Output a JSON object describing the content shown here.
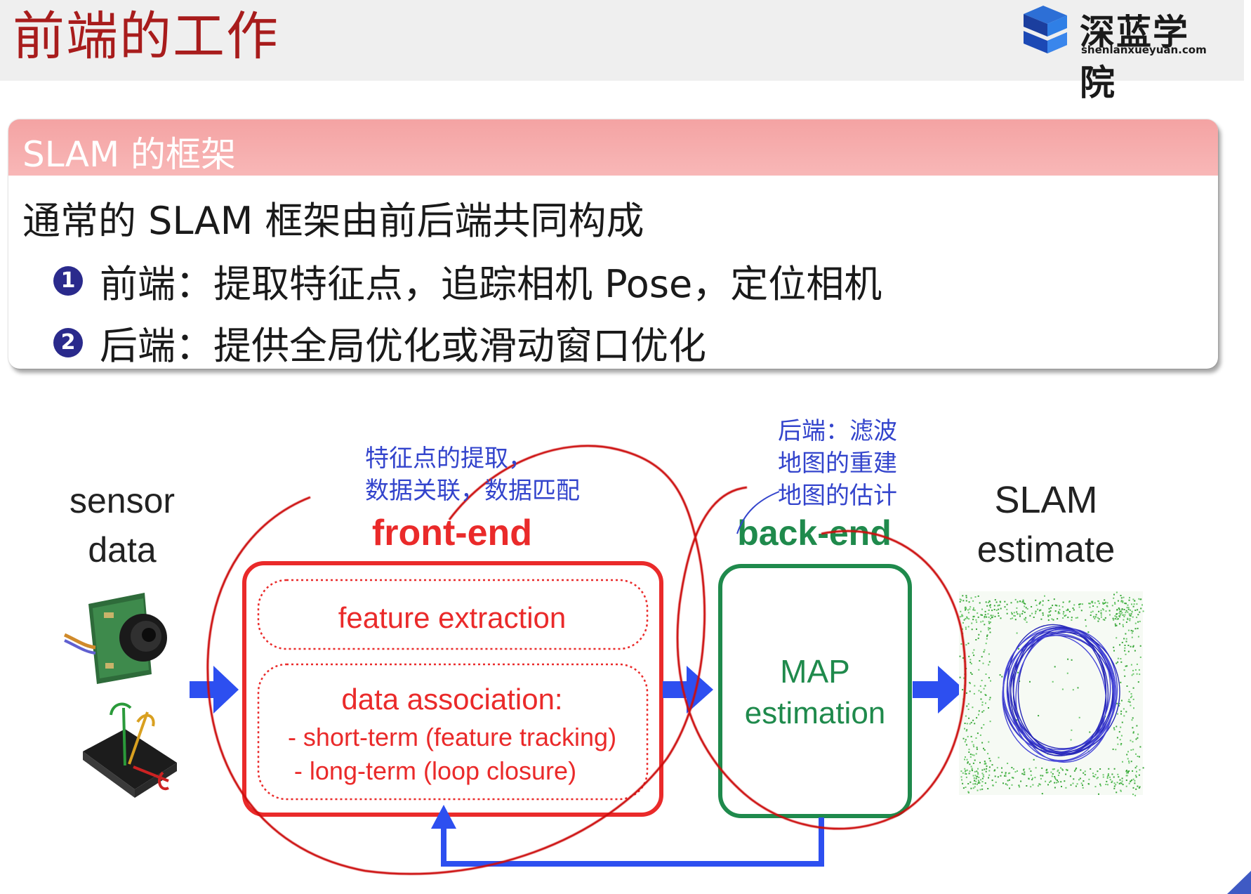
{
  "header": {
    "title": "前端的工作",
    "logo_cn": "深蓝学院",
    "logo_en": "shenlanxueyuan.com"
  },
  "card": {
    "title": "SLAM 的框架",
    "intro": "通常的 SLAM 框架由前后端共同构成",
    "bullets": [
      {
        "num": "1",
        "text": "前端：提取特征点，追踪相机 Pose，定位相机"
      },
      {
        "num": "2",
        "text": "后端：提供全局优化或滑动窗口优化"
      }
    ]
  },
  "annotations": {
    "front_note_line1": "特征点的提取，",
    "front_note_line2": "数据关联，数据匹配",
    "back_note_line1": "后端：滤波",
    "back_note_line2": "地图的重建",
    "back_note_line3": "地图的估计"
  },
  "diagram": {
    "sensor_line1": "sensor",
    "sensor_line2": "data",
    "frontend_title": "front-end",
    "feature_extraction": "feature extraction",
    "data_association": "data association:",
    "short_term": "- short-term (feature tracking)",
    "long_term": "- long-term (loop closure)",
    "backend_title": "back-end",
    "map_line1": "MAP",
    "map_line2": "estimation",
    "slam_line1": "SLAM",
    "slam_line2": "estimate"
  },
  "colors": {
    "title_red": "#a81c1c",
    "frontend_red": "#ea2a2a",
    "backend_green": "#1f8a4c",
    "arrow_blue": "#2d4ff0",
    "note_blue": "#3344cc",
    "card_header_pink": "#f4a3a3",
    "ink_red": "#cc1010"
  }
}
